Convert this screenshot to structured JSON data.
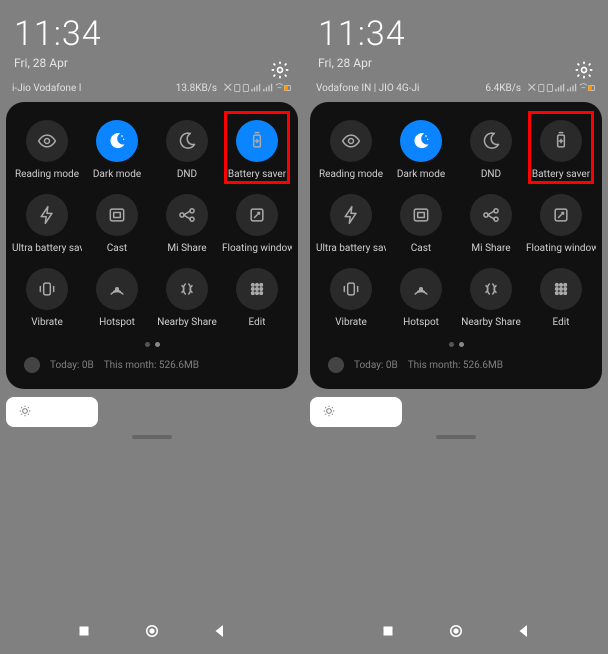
{
  "panels": [
    {
      "time": "11:34",
      "date": "Fri, 28 Apr",
      "carrier": "i-Jio         Vodafone I",
      "speed": "13.8KB/s",
      "tiles": [
        {
          "label": "Reading mode",
          "icon": "eye",
          "active": false,
          "highlight": false
        },
        {
          "label": "Dark mode",
          "icon": "moon-stars",
          "active": true,
          "highlight": false
        },
        {
          "label": "DND",
          "icon": "moon",
          "active": false,
          "highlight": false
        },
        {
          "label": "Battery saver",
          "icon": "battery",
          "active": true,
          "highlight": true
        },
        {
          "label": "Ultra battery sav",
          "icon": "bolt",
          "active": false,
          "highlight": false
        },
        {
          "label": "Cast",
          "icon": "cast",
          "active": false,
          "highlight": false
        },
        {
          "label": "Mi Share",
          "icon": "share",
          "active": false,
          "highlight": false
        },
        {
          "label": "Floating window",
          "icon": "floating",
          "active": false,
          "highlight": false
        },
        {
          "label": "Vibrate",
          "icon": "vibrate",
          "active": false,
          "highlight": false
        },
        {
          "label": "Hotspot",
          "icon": "hotspot",
          "active": false,
          "highlight": false
        },
        {
          "label": "Nearby Share",
          "icon": "nearby",
          "active": false,
          "highlight": false
        },
        {
          "label": "Edit",
          "icon": "edit",
          "active": false,
          "highlight": false
        }
      ],
      "usage_today": "Today: 0B",
      "usage_month": "This month: 526.6MB"
    },
    {
      "time": "11:34",
      "date": "Fri, 28 Apr",
      "carrier": "Vodafone IN | JIO 4G-Ji",
      "speed": "6.4KB/s",
      "tiles": [
        {
          "label": "Reading mode",
          "icon": "eye",
          "active": false,
          "highlight": false
        },
        {
          "label": "Dark mode",
          "icon": "moon-stars",
          "active": true,
          "highlight": false
        },
        {
          "label": "DND",
          "icon": "moon",
          "active": false,
          "highlight": false
        },
        {
          "label": "Battery saver",
          "icon": "battery",
          "active": false,
          "highlight": true
        },
        {
          "label": "Ultra battery sav",
          "icon": "bolt",
          "active": false,
          "highlight": false
        },
        {
          "label": "Cast",
          "icon": "cast",
          "active": false,
          "highlight": false
        },
        {
          "label": "Mi Share",
          "icon": "share",
          "active": false,
          "highlight": false
        },
        {
          "label": "Floating window",
          "icon": "floating",
          "active": false,
          "highlight": false
        },
        {
          "label": "Vibrate",
          "icon": "vibrate",
          "active": false,
          "highlight": false
        },
        {
          "label": "Hotspot",
          "icon": "hotspot",
          "active": false,
          "highlight": false
        },
        {
          "label": "Nearby Share",
          "icon": "nearby",
          "active": false,
          "highlight": false
        },
        {
          "label": "Edit",
          "icon": "edit",
          "active": false,
          "highlight": false
        }
      ],
      "usage_today": "Today: 0B",
      "usage_month": "This month: 526.6MB"
    }
  ]
}
